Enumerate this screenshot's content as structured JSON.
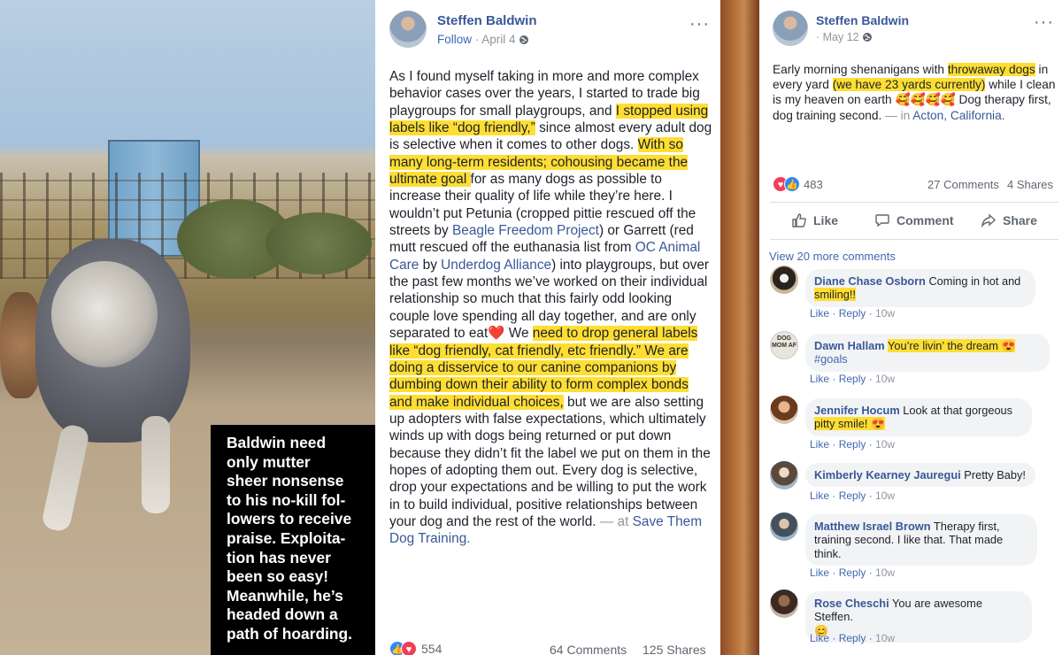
{
  "caption": {
    "lines": [
      "Baldwin need",
      "only mutter",
      "sheer nonsense",
      "to his no-kill fol-",
      "lowers to receive",
      "praise. Exploita-",
      "tion has never",
      "been so easy!",
      "Meanwhile, he’s",
      "headed down a",
      "path of hoarding."
    ]
  },
  "main_post": {
    "author": "Steffen Baldwin",
    "follow": "Follow",
    "dot": " · ",
    "date": "April 4",
    "privacy_icon": "globe-icon",
    "more": "···",
    "body": {
      "p1": "As I found myself taking in more and more complex behavior cases over the years, I started to trade big playgroups for small playgroups, and ",
      "h1": "I stopped using labels like “dog friendly,”",
      "p2": " since almost every adult dog is selective when it comes to other dogs. ",
      "h2": "With so many long-term residents; cohousing became the ultimate goal ",
      "p3": "for as many dogs as possible to increase their quality of life while they’re here. I wouldn’t put Petunia (cropped pittie rescued off the streets by ",
      "link1": "Beagle Freedom Project",
      "p4": ") or Garrett (red mutt rescued off the euthanasia list from ",
      "link2": "OC Animal Care",
      "p5": " by ",
      "link3": "Underdog Alliance",
      "p6": ") into playgroups, but over the past few months we’ve worked on their individual relationship so much that this fairly odd looking couple love spending all day together, and are only separated to eat",
      "heart": "❤️",
      "p7": " We ",
      "h3": "need to drop general labels like “dog friendly, cat friendly, etc friendly.” We are doing a disservice to our canine companions by dumbing down their ability to form complex bonds and make individual choices,",
      "p8": " but we are also setting up adopters with false expectations, which ultimately winds up with dogs being returned or put down because they didn’t fit the label we put on them in the hopes of adopting them out. Every dog is selective, drop your expectations and be willing to put the work in to build individual, positive relationships between your dog and the rest of the world.",
      "at": " — at ",
      "place": "Save Them Dog Training."
    },
    "reactions": {
      "count": "554",
      "icons": [
        "like-icon",
        "love-icon"
      ]
    },
    "comments": "64 Comments",
    "shares": "125 Shares"
  },
  "right_post": {
    "author": "Steffen Baldwin",
    "dot": " · ",
    "date": "May 12",
    "more": "···",
    "body": {
      "p1": "Early morning shenanigans with ",
      "h1": "throwaway dogs",
      "p2": " in every yard ",
      "h2": "(we have 23 yards currently)",
      "p3": " while I clean is my heaven on earth ",
      "emoji": "🥰🥰🥰🥰",
      "p4": " Dog therapy first, dog training second.",
      "in": " — in ",
      "place": "Acton, California."
    },
    "reactions": {
      "count": "483"
    },
    "comments": "27 Comments",
    "shares": "4 Shares",
    "actions": {
      "like": "Like",
      "comment": "Comment",
      "share": "Share"
    },
    "view_more": "View 20 more comments",
    "comment_list": [
      {
        "name": "Diane Chase Osborn",
        "text": "Coming in hot and",
        "text2": "smiling!!",
        "like": "Like",
        "reply": "Reply",
        "time": "10w"
      },
      {
        "name": "Dawn Hallam",
        "text": "You’re livin’ the dream 😍",
        "text2": "#goals",
        "like": "Like",
        "reply": "Reply",
        "time": "10w",
        "avatar_text": "DOG MOM AF"
      },
      {
        "name": "Jennifer Hocum",
        "text": "Look at that gorgeous",
        "text2": "pitty smile! 😍",
        "like": "Like",
        "reply": "Reply",
        "time": "10w"
      },
      {
        "name": "Kimberly Kearney Jauregui",
        "text": "Pretty Baby!",
        "like": "Like",
        "reply": "Reply",
        "time": "10w"
      },
      {
        "name": "Matthew Israel Brown",
        "text": "Therapy first,",
        "text2": "training second. I like that. That made think.",
        "like": "Like",
        "reply": "Reply",
        "time": "10w"
      },
      {
        "name": "Rose Cheschi",
        "text": "You are awesome Steffen.",
        "text2": "😊",
        "like": "Like",
        "reply": "Reply",
        "time": "10w"
      }
    ]
  },
  "colors": {
    "highlight": "#ffde33",
    "link": "#385898",
    "muted": "#90949c",
    "caption_bg": "#000000"
  }
}
